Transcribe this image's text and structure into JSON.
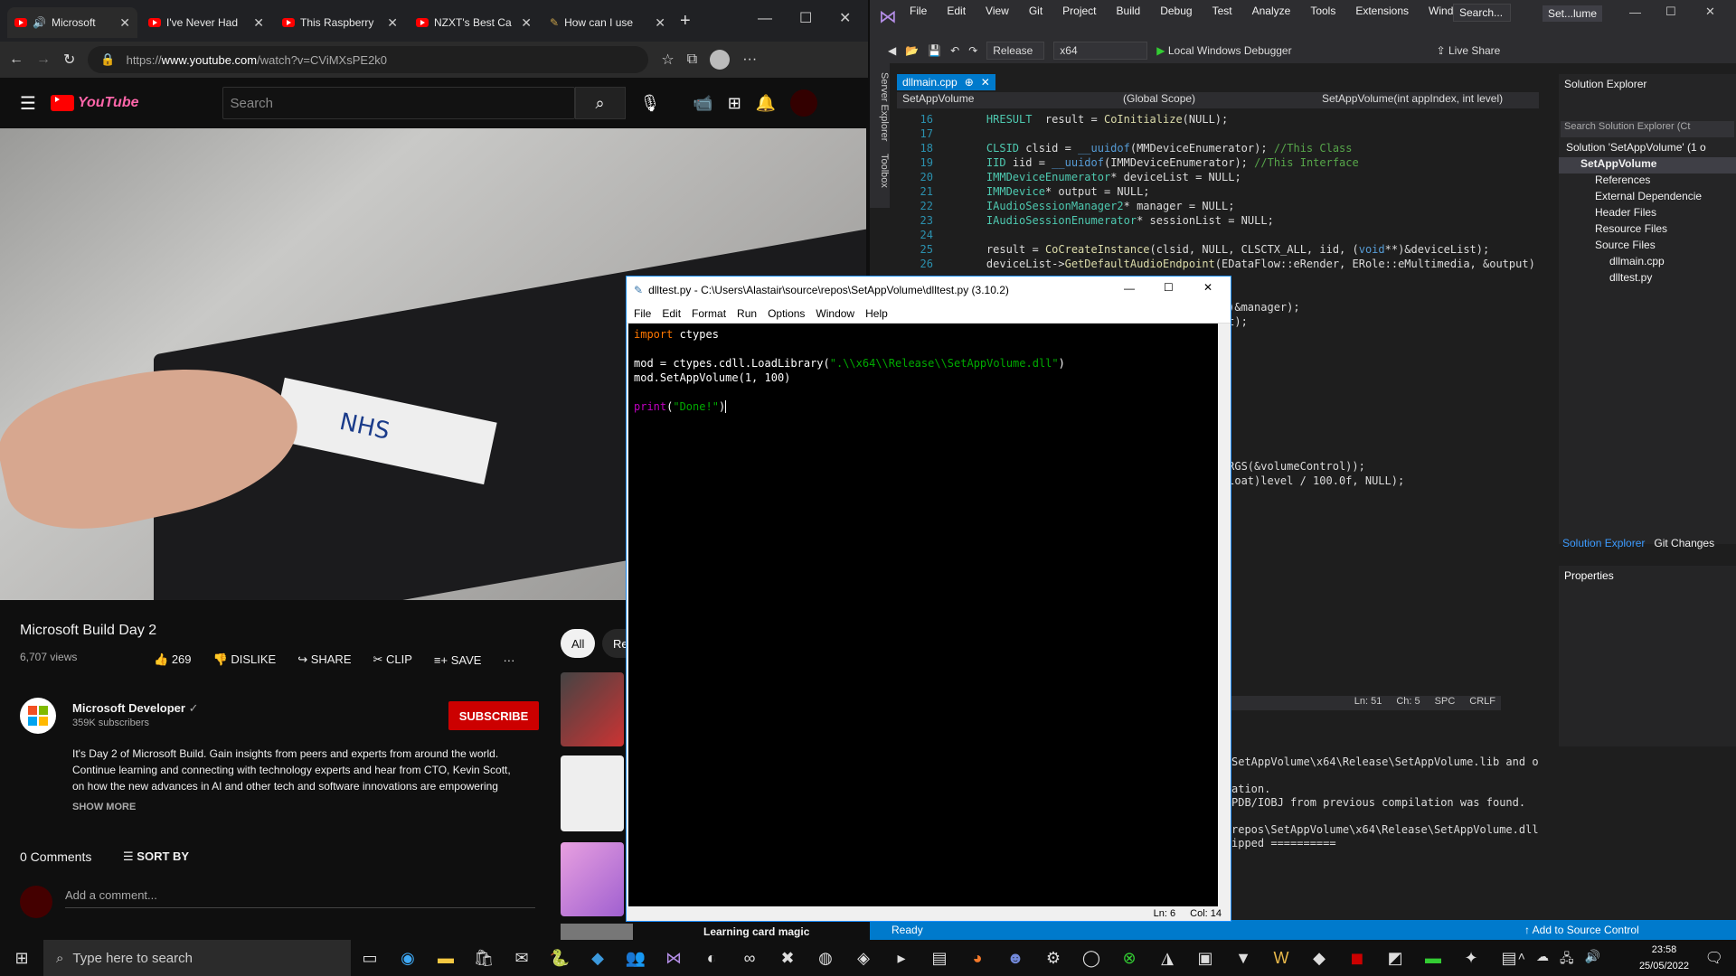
{
  "edge": {
    "tabs": [
      {
        "label": "Microsoft"
      },
      {
        "label": "I've Never Had"
      },
      {
        "label": "This Raspberry"
      },
      {
        "label": "NZXT's Best Ca"
      },
      {
        "label": "How can I use"
      }
    ],
    "url_prefix": "https://",
    "url_domain": "www.youtube.com",
    "url_path": "/watch?v=CViMXsPE2k0"
  },
  "youtube": {
    "search_placeholder": "Search",
    "logo_text": "YouTube",
    "video_tape_label": "NHS",
    "video_title": "Microsoft Build Day 2",
    "views": "6,707 views",
    "likes": "269",
    "dislike": "DISLIKE",
    "share": "SHARE",
    "clip": "CLIP",
    "save": "SAVE",
    "channel_name": "Microsoft Developer",
    "subscribers": "359K subscribers",
    "subscribe": "SUBSCRIBE",
    "description": "It's Day 2 of Microsoft Build. Gain insights from peers and experts from around the world. Continue learning and connecting with technology experts and hear from CTO, Kevin Scott, on how the new advances in AI and other tech and software innovations are empowering",
    "show_more": "SHOW MORE",
    "comments": "0 Comments",
    "sort_by": "SORT BY",
    "add_comment": "Add a comment...",
    "chip_all": "All",
    "chip_re": "Re",
    "related_bottom": "Learning card magic"
  },
  "idle": {
    "title": "dlltest.py - C:\\Users\\Alastair\\source\\repos\\SetAppVolume\\dlltest.py (3.10.2)",
    "menu": [
      "File",
      "Edit",
      "Format",
      "Run",
      "Options",
      "Window",
      "Help"
    ],
    "code": {
      "l1_kw": "import",
      "l1_rest": " ctypes",
      "l3_pre": "mod = ctypes.cdll.LoadLibrary(",
      "l3_str": "\".\\\\x64\\\\Release\\\\SetAppVolume.dll\"",
      "l3_post": ")",
      "l4": "mod.SetAppVolume(1, 100)",
      "l6_fn": "print",
      "l6_open": "(",
      "l6_str": "\"Done!\"",
      "l6_close": ")"
    },
    "status_ln": "Ln: 6",
    "status_col": "Col: 14"
  },
  "vs": {
    "menu": [
      "File",
      "Edit",
      "View",
      "Git",
      "Project",
      "Build",
      "Debug",
      "Test",
      "Analyze",
      "Tools",
      "Extensions",
      "Window",
      "Help"
    ],
    "search": "Search...",
    "solution_short": "Set...lume",
    "config": "Release",
    "platform": "x64",
    "debugger": "Local Windows Debugger",
    "live_share": "Live Share",
    "server_explorer": "Server Explorer",
    "toolbox": "Toolbox",
    "tab_file": "dllmain.cpp",
    "nav_project": "SetAppVolume",
    "nav_scope": "(Global Scope)",
    "nav_member": "SetAppVolume(int appIndex, int level)",
    "code_lines": [
      {
        "n": "16",
        "parts": [
          [
            "vty",
            "HRESULT"
          ],
          [
            "",
            "  result = "
          ],
          [
            "vfn",
            "CoInitialize"
          ],
          [
            "",
            "(NULL);"
          ]
        ]
      },
      {
        "n": "17",
        "parts": []
      },
      {
        "n": "18",
        "parts": [
          [
            "vty",
            "CLSID"
          ],
          [
            "",
            " clsid = "
          ],
          [
            "vkw",
            "__uuidof"
          ],
          [
            "",
            "(MMDeviceEnumerator); "
          ],
          [
            "vcm",
            "//This Class"
          ]
        ]
      },
      {
        "n": "19",
        "parts": [
          [
            "vty",
            "IID"
          ],
          [
            "",
            " iid = "
          ],
          [
            "vkw",
            "__uuidof"
          ],
          [
            "",
            "(IMMDeviceEnumerator); "
          ],
          [
            "vcm",
            "//This Interface"
          ]
        ]
      },
      {
        "n": "20",
        "parts": [
          [
            "vty",
            "IMMDeviceEnumerator"
          ],
          [
            "",
            "* deviceList = NULL;"
          ]
        ]
      },
      {
        "n": "21",
        "parts": [
          [
            "vty",
            "IMMDevice"
          ],
          [
            "",
            "* output = NULL;"
          ]
        ]
      },
      {
        "n": "22",
        "parts": [
          [
            "vty",
            "IAudioSessionManager2"
          ],
          [
            "",
            "* manager = NULL;"
          ]
        ]
      },
      {
        "n": "23",
        "parts": [
          [
            "vty",
            "IAudioSessionEnumerator"
          ],
          [
            "",
            "* sessionList = NULL;"
          ]
        ]
      },
      {
        "n": "24",
        "parts": []
      },
      {
        "n": "25",
        "parts": [
          [
            "",
            "result = "
          ],
          [
            "vfn",
            "CoCreateInstance"
          ],
          [
            "",
            "(clsid, NULL, CLSCTX_ALL, iid, ("
          ],
          [
            "vkw",
            "void"
          ],
          [
            "",
            "**)&deviceList);"
          ]
        ]
      },
      {
        "n": "26",
        "parts": [
          [
            "",
            "deviceList->"
          ],
          [
            "vfn",
            "GetDefaultAudioEndpoint"
          ],
          [
            "",
            "(EDataFlow::eRender, ERole::eMultimedia, &output)"
          ]
        ]
      }
    ],
    "code_tail": [
      {
        "row": 13,
        "text": "oid**)&manager);"
      },
      {
        "row": 14,
        "text": "onList);"
      },
      {
        "row": 21,
        "text": "rol);"
      },
      {
        "row": 24,
        "text": "PPV_ARGS(&volumeControl));"
      },
      {
        "row": 25,
        "text": "me((float)level / 100.0f, NULL);"
      }
    ],
    "editor_status": {
      "ln": "Ln: 51",
      "ch": "Ch: 5",
      "spc": "SPC",
      "crlf": "CRLF"
    },
    "solution_explorer": {
      "title": "Solution Explorer",
      "search": "Search Solution Explorer (Ct",
      "items": [
        {
          "label": "Solution 'SetAppVolume' (1 o",
          "indent": 0
        },
        {
          "label": "SetAppVolume",
          "indent": 1
        },
        {
          "label": "References",
          "indent": 2
        },
        {
          "label": "External Dependencie",
          "indent": 2
        },
        {
          "label": "Header Files",
          "indent": 2
        },
        {
          "label": "Resource Files",
          "indent": 2
        },
        {
          "label": "Source Files",
          "indent": 2
        },
        {
          "label": "dllmain.cpp",
          "indent": 3
        },
        {
          "label": "dlltest.py",
          "indent": 3
        }
      ],
      "tab1": "Solution Explorer",
      "tab2": "Git Changes"
    },
    "properties_title": "Properties",
    "output_lines": [
      "SetAppVolume\\x64\\Release\\SetAppVolume.lib and o",
      "",
      "ation.",
      "PDB/IOBJ from previous compilation was found.",
      "",
      "repos\\SetAppVolume\\x64\\Release\\SetAppVolume.dll",
      "ipped =========="
    ],
    "status_ready": "Ready",
    "source_control": "Add to Source Control"
  },
  "taskbar": {
    "search": "Type here to search",
    "time": "23:58",
    "date": "25/05/2022"
  }
}
